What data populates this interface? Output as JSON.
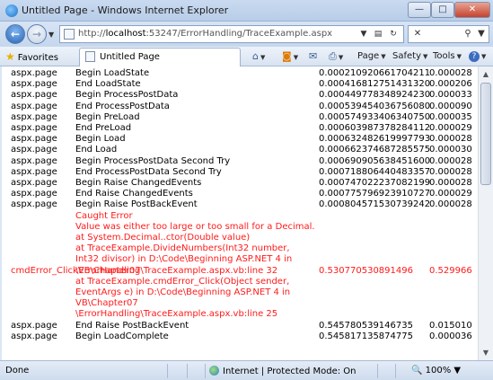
{
  "window": {
    "title": "Untitled Page - Windows Internet Explorer",
    "min_label": "—",
    "max_label": "□",
    "close_label": "✕"
  },
  "address": {
    "url_prefix": "http://",
    "url_host": "localhost",
    "url_path": ":53247/ErrorHandling/TraceExample.aspx"
  },
  "commandbar": {
    "favorites_label": "Favorites",
    "tab_label": "Untitled Page",
    "page_label": "Page",
    "safety_label": "Safety",
    "tools_label": "Tools"
  },
  "trace": {
    "rows_top": [
      {
        "category": "aspx.page",
        "message": "Begin LoadState",
        "from_first": "0.000210920661704211",
        "from_last": "0.000028"
      },
      {
        "category": "aspx.page",
        "message": "End LoadState",
        "from_first": "0.000416812751431320",
        "from_last": "0.000206"
      },
      {
        "category": "aspx.page",
        "message": "Begin ProcessPostData",
        "from_first": "0.000449778348924230",
        "from_last": "0.000033"
      },
      {
        "category": "aspx.page",
        "message": "End ProcessPostData",
        "from_first": "0.000539454036756080",
        "from_last": "0.000090"
      },
      {
        "category": "aspx.page",
        "message": "Begin PreLoad",
        "from_first": "0.000574933406340750",
        "from_last": "0.000035"
      },
      {
        "category": "aspx.page",
        "message": "End PreLoad",
        "from_first": "0.000603987378284112",
        "from_last": "0.000029"
      },
      {
        "category": "aspx.page",
        "message": "Begin Load",
        "from_first": "0.000632482619997793",
        "from_last": "0.000028"
      },
      {
        "category": "aspx.page",
        "message": "End Load",
        "from_first": "0.000662374687285575",
        "from_last": "0.000030"
      },
      {
        "category": "aspx.page",
        "message": "Begin ProcessPostData Second Try",
        "from_first": "0.000690905638451600",
        "from_last": "0.000028"
      },
      {
        "category": "aspx.page",
        "message": "End ProcessPostData Second Try",
        "from_first": "0.000718806440483357",
        "from_last": "0.000028"
      },
      {
        "category": "aspx.page",
        "message": "Begin Raise ChangedEvents",
        "from_first": "0.000747022237082199",
        "from_last": "0.000028"
      },
      {
        "category": "aspx.page",
        "message": "End Raise ChangedEvents",
        "from_first": "0.000775796923910727",
        "from_last": "0.000029"
      },
      {
        "category": "aspx.page",
        "message": "Begin Raise PostBackEvent",
        "from_first": "0.000804571530739242",
        "from_last": "0.000028"
      }
    ],
    "error": {
      "category": "cmdError_ClickVB\\Chapter07",
      "from_first": "0.530770530891496",
      "from_last": "0.529966",
      "lines": [
        "Caught Error",
        "Value was either too large or too small for a Decimal.",
        "   at System.Decimal..ctor(Double value)",
        "   at TraceExample.DivideNumbers(Int32 number,",
        "Int32 divisor) in D:\\Code\\Beginning ASP.NET 4 in",
        "\\ErrorHandling\\TraceExample.aspx.vb:line 32",
        "   at TraceExample.cmdError_Click(Object sender,",
        "EventArgs e) in D:\\Code\\Beginning ASP.NET 4 in",
        "VB\\Chapter07",
        "\\ErrorHandling\\TraceExample.aspx.vb:line 25"
      ]
    },
    "rows_bottom": [
      {
        "category": "aspx.page",
        "message": "End Raise PostBackEvent",
        "from_first": "0.545780539146735",
        "from_last": "0.015010"
      },
      {
        "category": "aspx.page",
        "message": "Begin LoadComplete",
        "from_first": "0.545817135874775",
        "from_last": "0.000036"
      }
    ]
  },
  "status": {
    "done_label": "Done",
    "zone_label": "Internet | Protected Mode: On",
    "zoom_label": "100%"
  }
}
